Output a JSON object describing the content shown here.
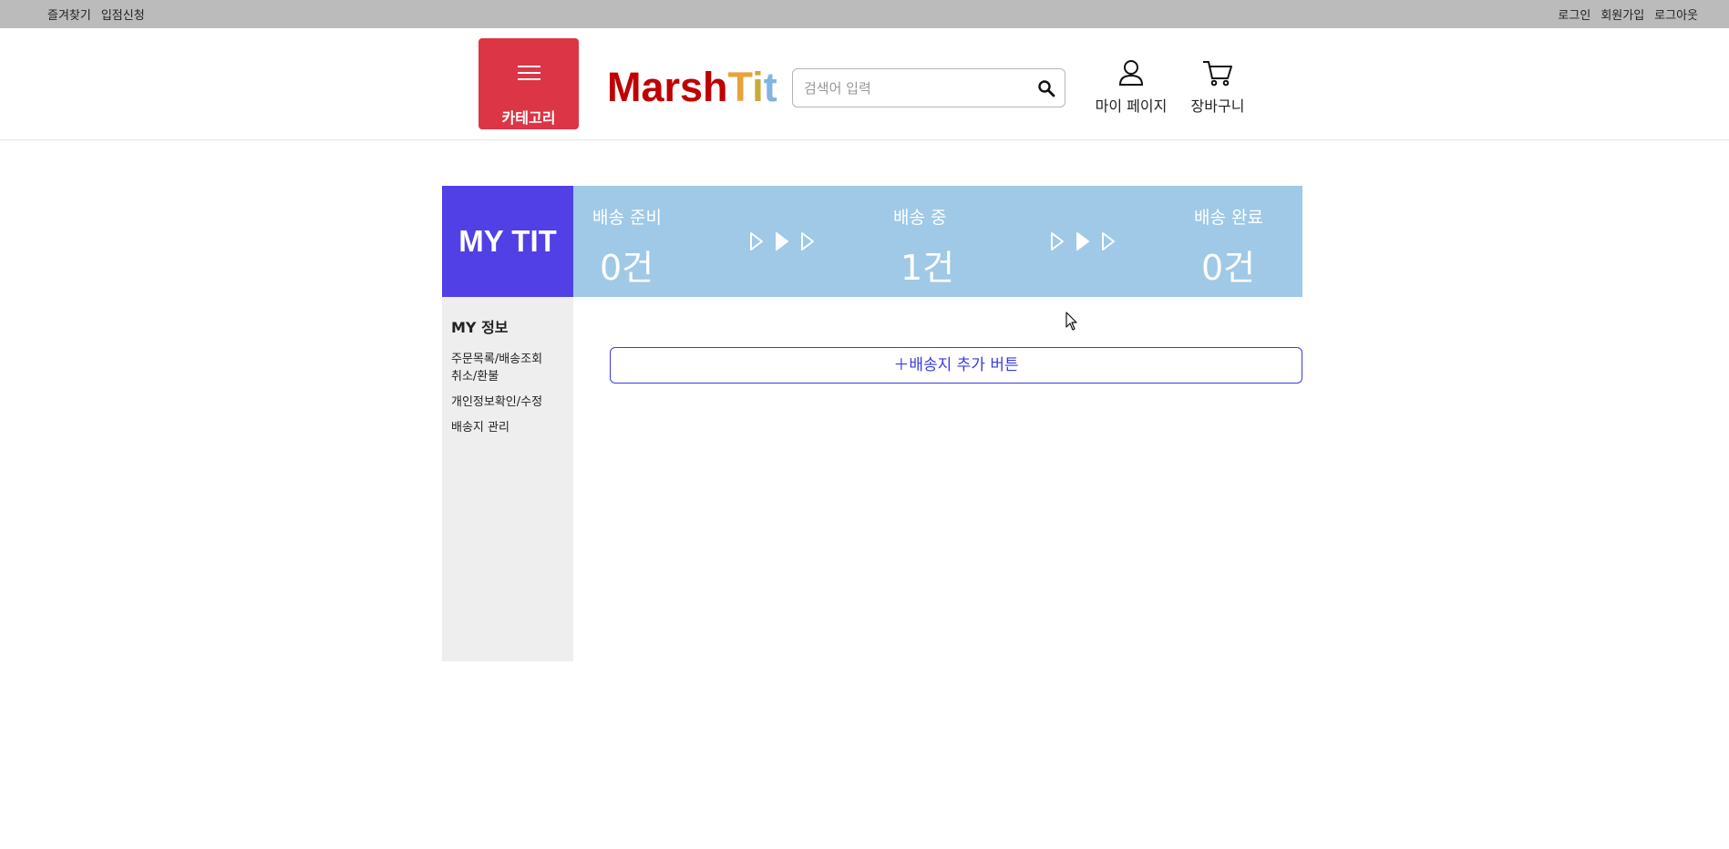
{
  "topbar": {
    "left_links": [
      "즐겨찾기",
      "입점신청"
    ],
    "right_links": [
      "로그인",
      "회원가입",
      "로그아웃"
    ]
  },
  "header": {
    "category_label": "카테고리",
    "logo": {
      "part1": "Marsh",
      "part2": "T",
      "part3": "i",
      "part4": "t"
    },
    "search_placeholder": "검색어 입력",
    "mypage_label": "마이 페이지",
    "cart_label": "장바구니"
  },
  "mytit": {
    "title": "MY TIT",
    "stages": [
      {
        "label": "배송 준비",
        "count": "0건"
      },
      {
        "label": "배송 중",
        "count": "1건"
      },
      {
        "label": "배송 완료",
        "count": "0건"
      }
    ]
  },
  "sidebar": {
    "title": "MY 정보",
    "items": [
      "주문목록/배송조회",
      "취소/환불",
      "개인정보확인/수정",
      "배송지 관리"
    ]
  },
  "main": {
    "add_address_label": "＋배송지 추가 버튼"
  },
  "colors": {
    "topbar": "#bbbbbb",
    "category_button": "#dc3545",
    "mytit_bg": "#5040e6",
    "status_bg": "#9fc9e6",
    "sidebar_bg": "#eeeeee",
    "accent_blue": "#3a3ae6"
  }
}
